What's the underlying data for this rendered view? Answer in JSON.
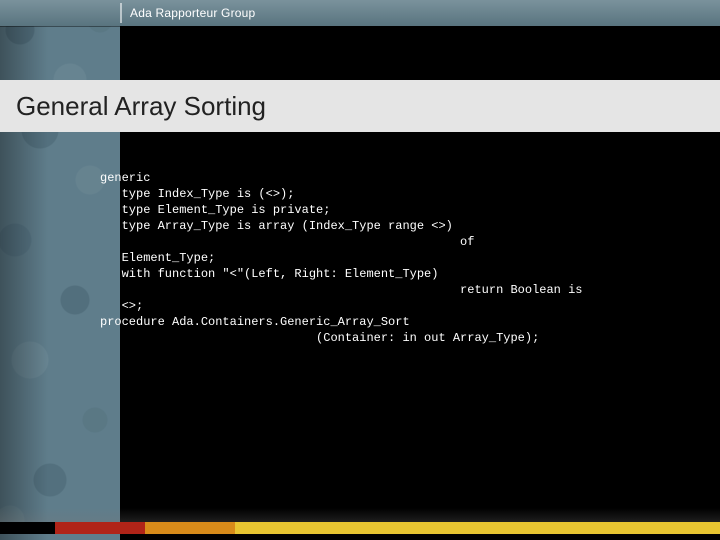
{
  "header": {
    "group": "Ada Rapporteur Group"
  },
  "title": "General Array Sorting",
  "code": {
    "l1": "generic",
    "l2": "   type Index_Type is (<>);",
    "l3": "   type Element_Type is private;",
    "l4": "   type Array_Type is array (Index_Type range <>)",
    "l5": "                                                  of",
    "l6": "   Element_Type;",
    "l7": "   with function \"<\"(Left, Right: Element_Type)",
    "l8": "                                                  return Boolean is",
    "l9": "   <>;",
    "l10": "procedure Ada.Containers.Generic_Array_Sort",
    "l11": "                              (Container: in out Array_Type);"
  },
  "accent": {
    "red": "#b02418",
    "orange": "#d88b1a",
    "yellow": "#e8c531"
  }
}
